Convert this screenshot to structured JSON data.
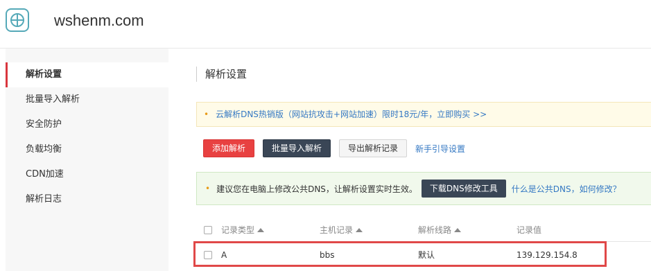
{
  "header": {
    "site_name": "wshenm.com"
  },
  "sidebar": {
    "items": [
      {
        "label": "解析设置"
      },
      {
        "label": "批量导入解析"
      },
      {
        "label": "安全防护"
      },
      {
        "label": "负载均衡"
      },
      {
        "label": "CDN加速"
      },
      {
        "label": "解析日志"
      }
    ]
  },
  "main": {
    "title": "解析设置",
    "notice": "云解析DNS热销版（网站抗攻击+网站加速）限时18元/年，立即购买 >>",
    "toolbar": {
      "add": "添加解析",
      "batch_import": "批量导入解析",
      "export": "导出解析记录",
      "guide": "新手引导设置"
    },
    "dns_tip": {
      "text": "建议您在电脑上修改公共DNS，让解析设置实时生效。",
      "download_button": "下载DNS修改工具",
      "help_link": "什么是公共DNS，如何修改？"
    },
    "table": {
      "columns": [
        "记录类型",
        "主机记录",
        "解析线路",
        "记录值"
      ],
      "rows": [
        {
          "type": "A",
          "host": "bbs",
          "line": "默认",
          "value": "139.129.154.8"
        }
      ]
    }
  },
  "colors": {
    "accent_red": "#e84141",
    "dark_button": "#3a4656",
    "link_blue": "#3478c3",
    "highlight": "#e04848"
  }
}
